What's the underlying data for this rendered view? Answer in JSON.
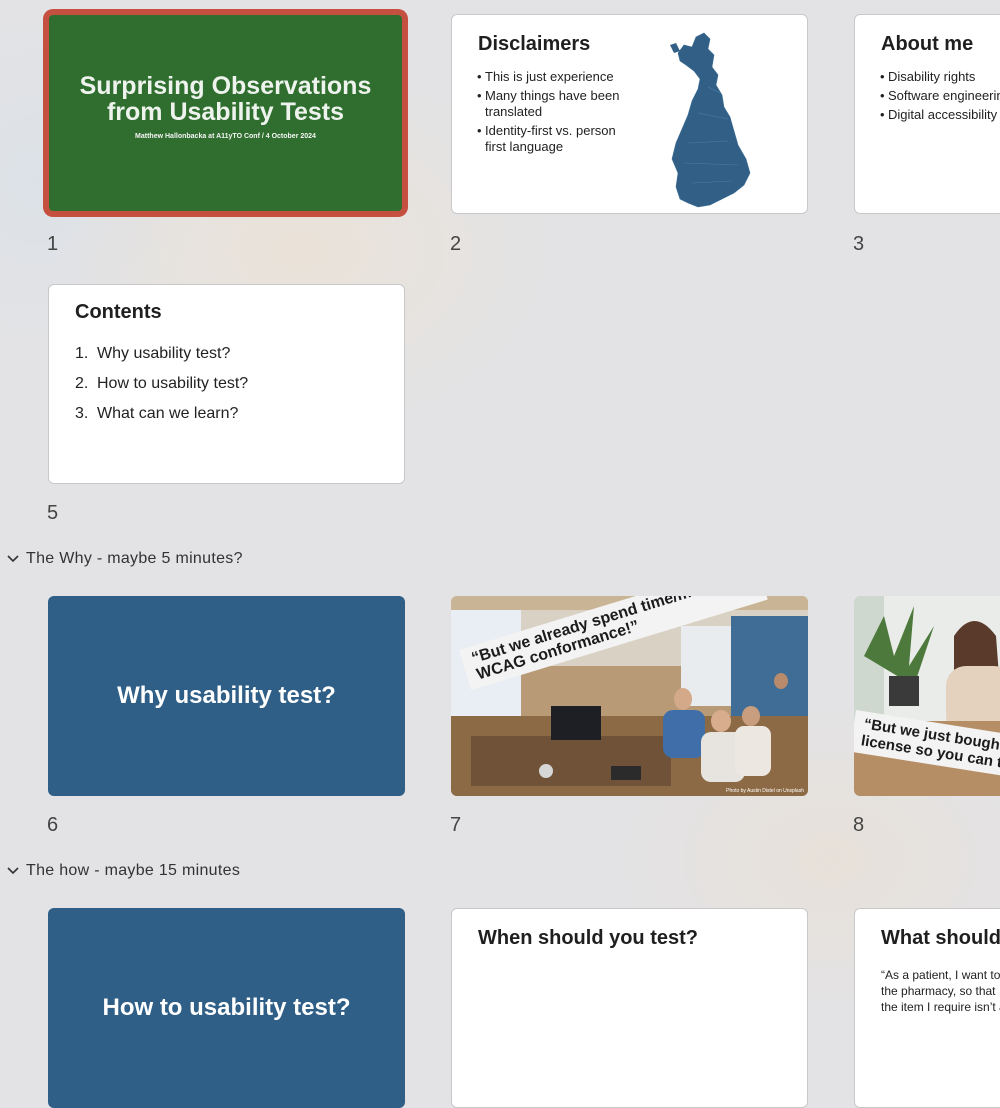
{
  "slides": [
    {
      "number": "1",
      "title_line1": "Surprising Observations",
      "title_line2": "from Usability Tests",
      "subtitle": "Matthew Hallonbacka at A11yTO Conf / 4 October 2024",
      "color": "#2f6e2e",
      "selected": true
    },
    {
      "number": "2",
      "title": "Disclaimers",
      "bullets": [
        "This is just experience",
        "Many things have been translated",
        "Identity-first vs. person first language"
      ],
      "image": "finland-map"
    },
    {
      "number": "3",
      "title": "About me",
      "bullets": [
        "Disability rights",
        "Software engineerin",
        "Digital accessibility"
      ]
    },
    {
      "number": "5",
      "title": "Contents",
      "items": [
        {
          "n": "1.",
          "text": "Why usability test?"
        },
        {
          "n": "2.",
          "text": "How to usability test?"
        },
        {
          "n": "3.",
          "text": "What can we learn?"
        }
      ]
    },
    {
      "number": "6",
      "title": "Why usability test?",
      "color": "#2f5f87"
    },
    {
      "number": "7",
      "banner_line1": "“But we already spend time/money on",
      "banner_line2": "WCAG conformance!”",
      "credit": "Photo by Austin Distel on Unsplash",
      "image": "office-meeting-photo"
    },
    {
      "number": "8",
      "banner_line1": "“But we just bought y",
      "banner_line2": "license so you can tes",
      "image": "woman-at-table-photo"
    },
    {
      "number": "",
      "title": "How to usability test?",
      "color": "#2f5f87"
    },
    {
      "number": "",
      "title": "When should you test?"
    },
    {
      "number": "",
      "title": "What should y",
      "quote_lines": [
        "“As a patient, I want to c",
        "the pharmacy, so that I a",
        "the item I require isn’t a"
      ]
    }
  ],
  "sections": [
    {
      "label": "The Why - maybe 5 minutes?",
      "icon": "chevron-down-icon"
    },
    {
      "label": "The how - maybe 15 minutes",
      "icon": "chevron-down-icon"
    }
  ]
}
